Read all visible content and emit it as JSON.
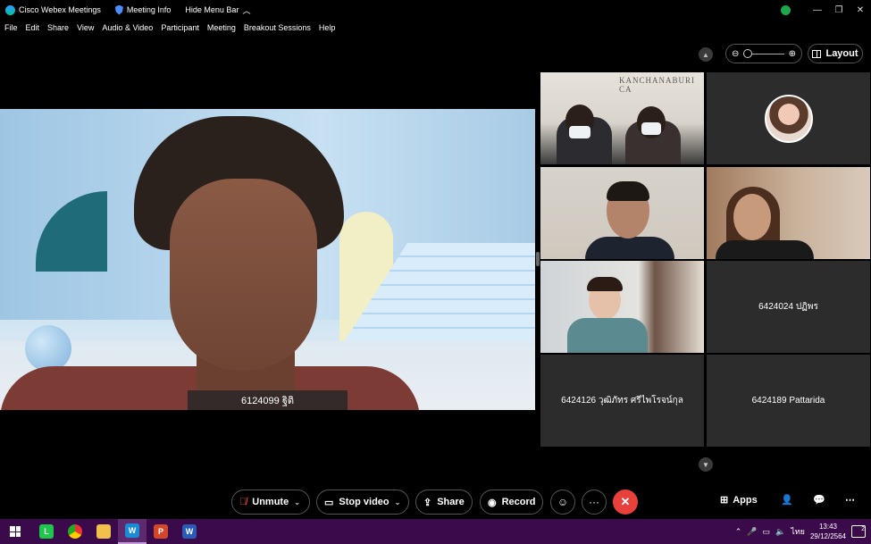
{
  "titlebar": {
    "app_name": "Cisco Webex Meetings",
    "meeting_info": "Meeting Info",
    "hide_menu_bar": "Hide Menu Bar",
    "status_badge": "all"
  },
  "menubar": {
    "items": [
      "File",
      "Edit",
      "Share",
      "View",
      "Audio & Video",
      "Participant",
      "Meeting",
      "Breakout Sessions",
      "Help"
    ]
  },
  "view_controls": {
    "layout_label": "Layout"
  },
  "main_video": {
    "name": "6124099 ฐิติ"
  },
  "grid": {
    "tile1_banner": "KANCHANABURI CA",
    "tile6_name": "6424024 ปฏิพร",
    "tile7_name": "6424126 วุฒิภัทร ศรีไพโรจน์กุล",
    "tile8_name": "6424189 Pattarida"
  },
  "controls": {
    "unmute": "Unmute",
    "stop_video": "Stop video",
    "share": "Share",
    "record": "Record",
    "more": "···",
    "apps": "Apps"
  },
  "taskbar": {
    "ime": "ไทย",
    "time": "13:43",
    "date": "29/12/2564",
    "notifications": "2"
  },
  "colors": {
    "end_call": "#e8413c",
    "taskbar": "#3b0a4a"
  }
}
